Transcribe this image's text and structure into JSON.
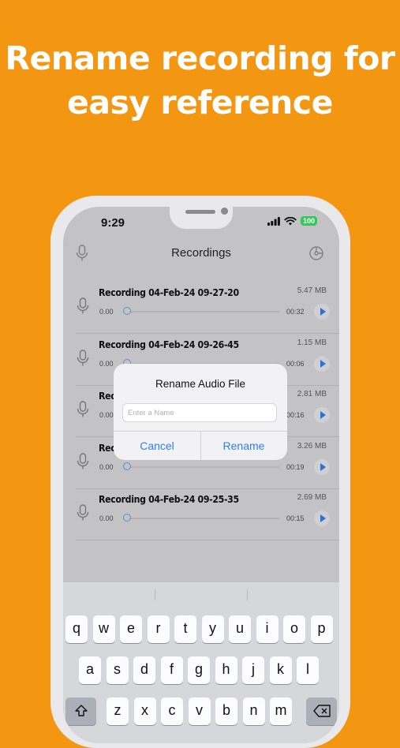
{
  "headline": {
    "line1": "Rename recording for",
    "line2": "easy reference"
  },
  "status_bar": {
    "time": "9:29",
    "battery": "100"
  },
  "nav": {
    "title": "Recordings",
    "left_icon": "mic-icon",
    "right_icon": "settings-dial-icon"
  },
  "recordings": [
    {
      "title": "Recording 04-Feb-24 09-27-20",
      "size": "5.47 MB",
      "start": "0.00",
      "duration": "00:32"
    },
    {
      "title": "Recording 04-Feb-24 09-26-45",
      "size": "1.15 MB",
      "start": "0.00",
      "duration": "00:06"
    },
    {
      "title": "Rec",
      "size": "2.81 MB",
      "start": "0.00",
      "duration": "00:16"
    },
    {
      "title": "Rec",
      "size": "3.26 MB",
      "start": "0.00",
      "duration": "00:19"
    },
    {
      "title": "Recording 04-Feb-24 09-25-35",
      "size": "2.69 MB",
      "start": "0.00",
      "duration": "00:15"
    }
  ],
  "dialog": {
    "title": "Rename Audio File",
    "placeholder": "Enter a Name",
    "cancel_label": "Cancel",
    "confirm_label": "Rename"
  },
  "keyboard": {
    "row1": [
      "q",
      "w",
      "e",
      "r",
      "t",
      "y",
      "u",
      "i",
      "o",
      "p"
    ],
    "row2": [
      "a",
      "s",
      "d",
      "f",
      "g",
      "h",
      "j",
      "k",
      "l"
    ],
    "row3": [
      "z",
      "x",
      "c",
      "v",
      "b",
      "n",
      "m"
    ],
    "shift_icon": "shift-icon",
    "delete_icon": "backspace-icon"
  },
  "colors": {
    "background": "#F39612",
    "accent": "#2F7CF6",
    "battery": "#34C759"
  }
}
